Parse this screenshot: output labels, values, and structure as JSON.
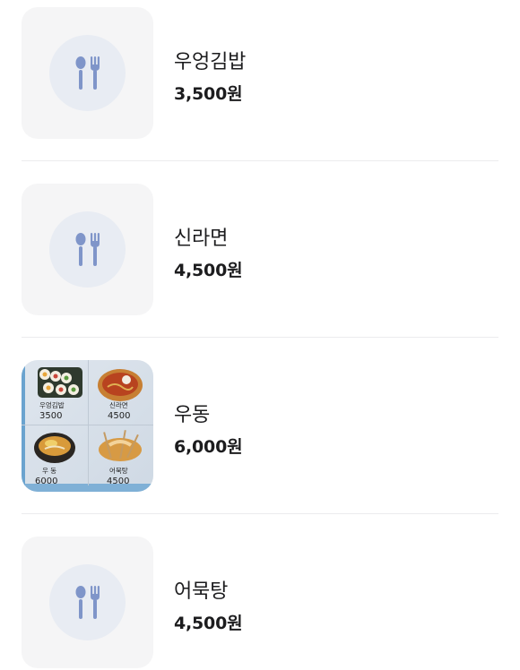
{
  "menu": {
    "items": [
      {
        "name": "우엉김밥",
        "price": "3,500원",
        "image": "utensils-placeholder-icon"
      },
      {
        "name": "신라면",
        "price": "4,500원",
        "image": "utensils-placeholder-icon"
      },
      {
        "name": "우동",
        "price": "6,000원",
        "image": "menu-board-photo"
      },
      {
        "name": "어묵탕",
        "price": "4,500원",
        "image": "utensils-placeholder-icon"
      }
    ]
  },
  "photo": {
    "labels": [
      "우엉김밥",
      "신라면",
      "우 동",
      "어묵탕"
    ],
    "prices": [
      "3500",
      "4500",
      "6000",
      "4500"
    ]
  },
  "colors": {
    "utensil": "#7f95c9",
    "plate": "#e8ecf3",
    "thumb_bg": "#f5f5f6",
    "divider": "#ececee"
  }
}
